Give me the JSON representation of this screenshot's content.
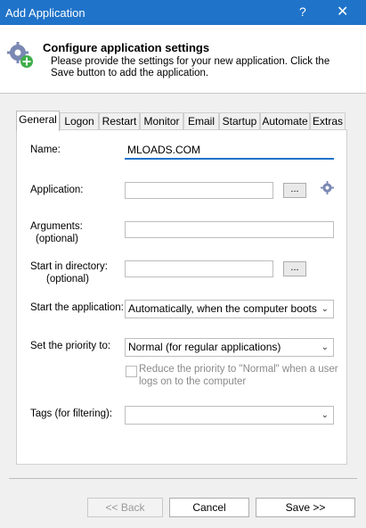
{
  "window": {
    "title": "Add Application",
    "help": "?",
    "close": "✕"
  },
  "header": {
    "title": "Configure application settings",
    "description": "Please provide the settings for your new application. Click the Save button to add the application."
  },
  "tabs": [
    "General",
    "Logon",
    "Restart",
    "Monitor",
    "Email",
    "Startup",
    "Automate",
    "Extras"
  ],
  "form": {
    "name_label": "Name:",
    "name_value": "MLOADS.COM",
    "application_label": "Application:",
    "application_value": "",
    "browse_label": "...",
    "arguments_label_1": "Arguments:",
    "arguments_label_2": "(optional)",
    "arguments_value": "",
    "start_dir_label_1": "Start in directory:",
    "start_dir_label_2": "(optional)",
    "start_dir_value": "",
    "start_app_label": "Start the application:",
    "start_app_value": "Automatically, when the computer boots",
    "priority_label": "Set the priority to:",
    "priority_value": "Normal (for regular applications)",
    "reduce_priority_line1": "Reduce the priority to \"Normal\" when a user",
    "reduce_priority_line2": "logs on to the computer",
    "tags_label": "Tags (for filtering):",
    "tags_value": ""
  },
  "footer": {
    "back": "<< Back",
    "cancel": "Cancel",
    "save": "Save >>"
  },
  "icons": {
    "header": "gear-plus-icon",
    "app": "gear-icon"
  }
}
